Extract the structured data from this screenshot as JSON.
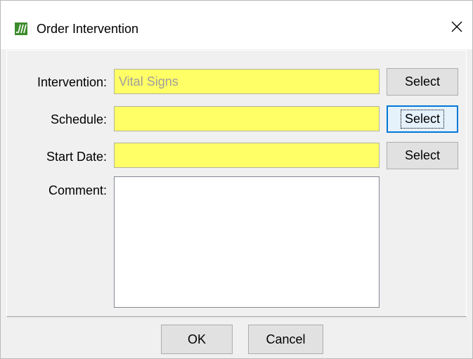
{
  "window": {
    "title": "Order Intervention",
    "app_icon": "app-logo-icon",
    "close_icon": "close-icon",
    "accent_color": "#3d8b2c"
  },
  "form": {
    "intervention": {
      "label": "Intervention:",
      "value": "Vital Signs",
      "button_label": "Select"
    },
    "schedule": {
      "label": "Schedule:",
      "value": "",
      "button_label": "Select"
    },
    "start_date": {
      "label": "Start Date:",
      "value": "",
      "button_label": "Select"
    },
    "comment": {
      "label": "Comment:",
      "value": ""
    },
    "required_field_color": "#ffff66"
  },
  "footer": {
    "ok_label": "OK",
    "cancel_label": "Cancel"
  }
}
